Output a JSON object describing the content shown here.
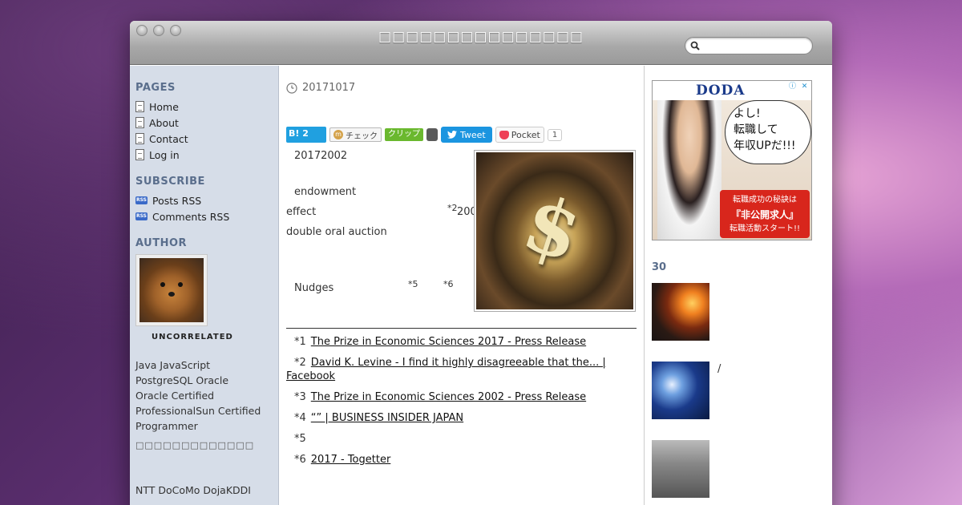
{
  "site": {
    "title": "□□□□□□□□□□□□□□□"
  },
  "search": {
    "placeholder": ""
  },
  "sidebar": {
    "pages_heading": "PAGES",
    "pages": [
      "Home",
      "About",
      "Contact",
      "Log in"
    ],
    "subscribe_heading": "SUBSCRIBE",
    "subscribe": [
      "Posts RSS",
      "Comments RSS"
    ],
    "rss_badge": "RSS",
    "author_heading": "AUTHOR",
    "author_name": "UNCORRELATED",
    "author_bio": [
      "Java JavaScript",
      "PostgreSQL Oracle",
      "Oracle Certified",
      "ProfessionalSun Certified",
      "Programmer"
    ],
    "author_bio_extra": "□□□□□□□□□□□□□",
    "author_footer": "NTT DoCoMo DojaKDDI"
  },
  "post": {
    "date": "20171017",
    "share": {
      "hatena_label": "B!",
      "hatena_count": "2",
      "mixi_label": "チェック",
      "mixi_badge": "m",
      "clip_label": "クリップ",
      "tweet_label": "Tweet",
      "pocket_label": "Pocket",
      "pocket_count": "1"
    },
    "body": {
      "p1": "20172002",
      "p2": "endowment",
      "p3a": "effect",
      "p3b": "*2",
      "p3c": "200",
      "p4": "double oral auction",
      "p5a": "Nudges",
      "p5b": "*5",
      "p5c": "*6"
    },
    "hero_symbol": "$",
    "footnotes": [
      {
        "num": "*1",
        "text": "The Prize in Economic Sciences 2017 - Press Release"
      },
      {
        "num": "*2",
        "text": "David K. Levine - I find it highly disagreeable that the... | Facebook"
      },
      {
        "num": "*3",
        "text": "The Prize in Economic Sciences 2002 - Press Release"
      },
      {
        "num": "*4",
        "text": "“” | BUSINESS INSIDER JAPAN"
      },
      {
        "num": "*5",
        "text": ""
      },
      {
        "num": "*6",
        "text": "2017 - Togetter"
      }
    ]
  },
  "ad": {
    "logo": "DODA",
    "info_icon": "ⓘ",
    "close_icon": "✕",
    "bubble": [
      "よし!",
      "転職して",
      "年収UPだ!!!"
    ],
    "banner_line1": "転職成功の秘訣は",
    "banner_line2": "『非公開求人』",
    "banner_line3": "転職活動スタート!!"
  },
  "popular": {
    "heading": "30",
    "items": [
      {
        "text": ""
      },
      {
        "text": "/"
      },
      {
        "text": ""
      }
    ]
  }
}
